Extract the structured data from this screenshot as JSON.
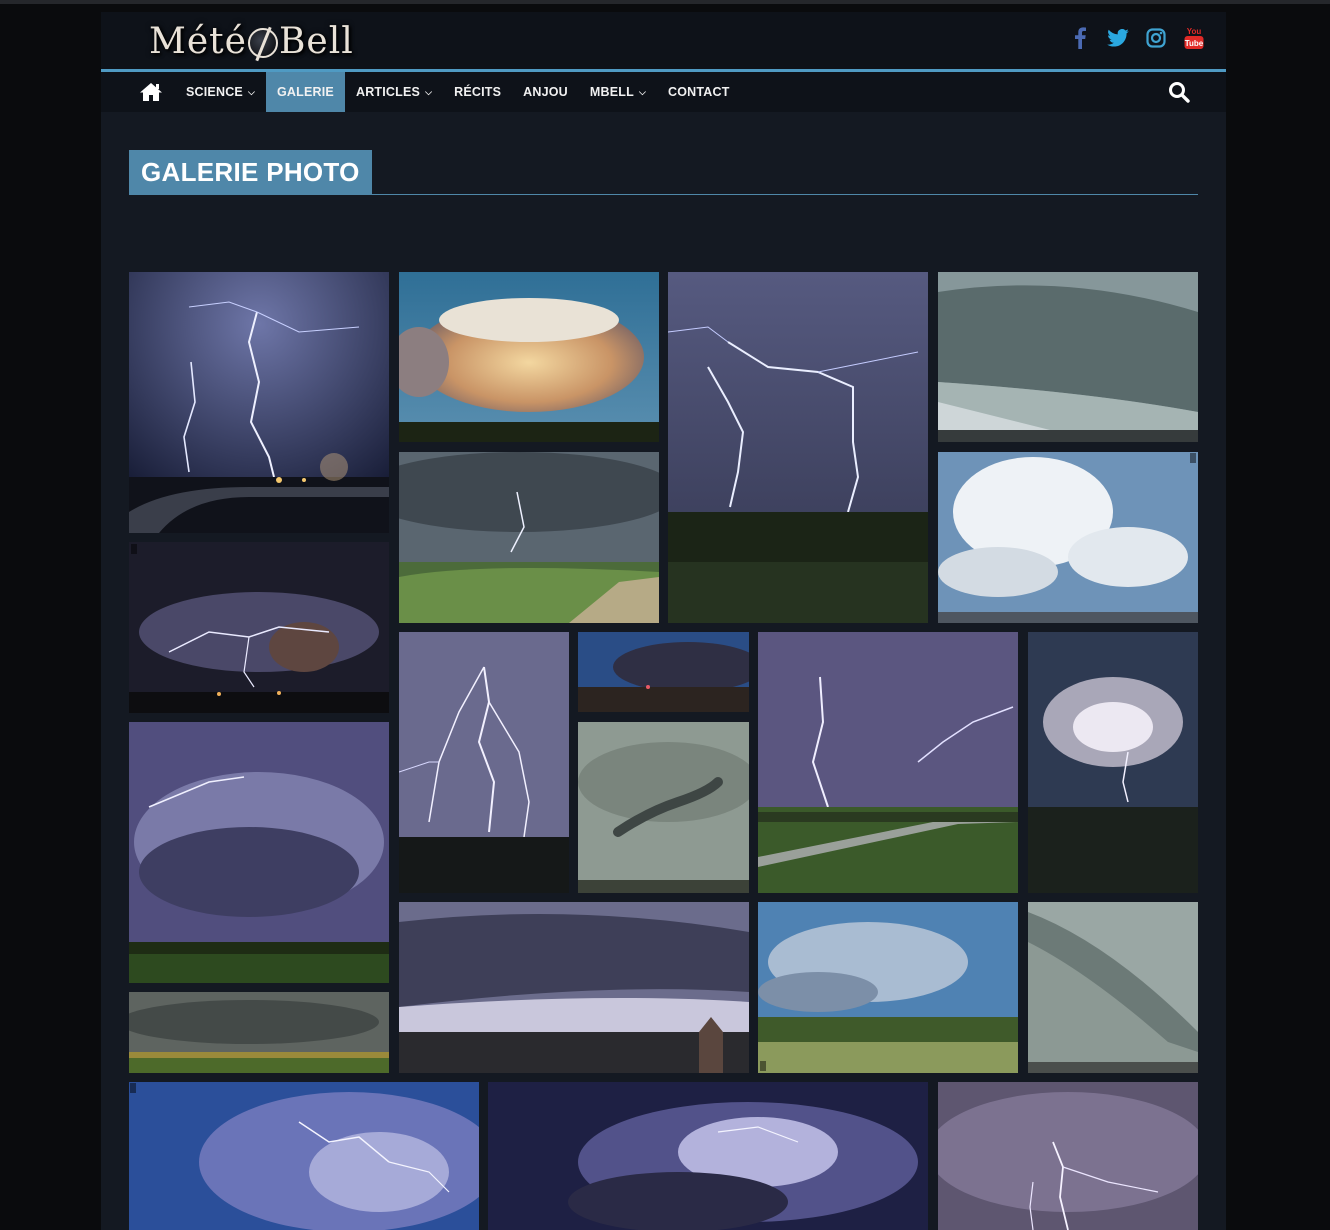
{
  "site": {
    "logo_text": [
      "Mété",
      "Bell"
    ]
  },
  "socials": [
    {
      "icon": "facebook-icon",
      "color": "#4b6ab3"
    },
    {
      "icon": "twitter-icon",
      "color": "#2aa8e0"
    },
    {
      "icon": "instagram-icon",
      "color": "#3fa3d1"
    },
    {
      "icon": "youtube-icon",
      "color": "#e02a27",
      "label_top": "You",
      "label_bottom": "Tube"
    }
  ],
  "nav": {
    "items": [
      {
        "label": "SCIENCE",
        "has_dropdown": true
      },
      {
        "label": "GALERIE",
        "active": true
      },
      {
        "label": "ARTICLES",
        "has_dropdown": true
      },
      {
        "label": "RÉCITS"
      },
      {
        "label": "ANJOU"
      },
      {
        "label": "MBELL",
        "has_dropdown": true
      },
      {
        "label": "CONTACT"
      }
    ],
    "accent": "#4f87a9",
    "border": "#4f9ac3"
  },
  "page": {
    "title": "GALERIE PHOTO"
  },
  "gallery": {
    "photos": [
      {
        "subject": "lightning-road-night"
      },
      {
        "subject": "sunset-thunderhead"
      },
      {
        "subject": "lightning-purple-field"
      },
      {
        "subject": "shelf-cloud-building"
      },
      {
        "subject": "cumulonimbus-white"
      },
      {
        "subject": "lightning-hills-day"
      },
      {
        "subject": "intracloud-lightning-night"
      },
      {
        "subject": "lightning-multi-bolt"
      },
      {
        "subject": "dusk-storm-horizon"
      },
      {
        "subject": "funnel-cloud"
      },
      {
        "subject": "lightning-vineyard"
      },
      {
        "subject": "lit-storm-clouds"
      },
      {
        "subject": "supercell-purple"
      },
      {
        "subject": "grey-storm-field"
      },
      {
        "subject": "shelf-cloud-village"
      },
      {
        "subject": "cumulus-countryside"
      },
      {
        "subject": "grey-shelf-cloud"
      },
      {
        "subject": "blue-night-lightning"
      },
      {
        "subject": "dark-lightning-clouds"
      },
      {
        "subject": "lightning-pink-sky"
      }
    ]
  }
}
